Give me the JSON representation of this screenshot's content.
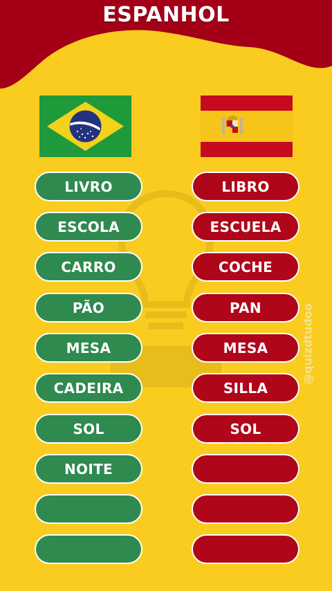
{
  "header": {
    "title": "ESPANHOL",
    "bg_color": "#a30017"
  },
  "colors": {
    "background": "#f9cc1f",
    "portuguese_pill": "#2e8a4f",
    "spanish_pill": "#b0061a"
  },
  "flags": {
    "left": "brazil-flag",
    "right": "spain-flag"
  },
  "words": [
    {
      "pt": "LIVRO",
      "es": "LIBRO"
    },
    {
      "pt": "ESCOLA",
      "es": "ESCUELA"
    },
    {
      "pt": "CARRO",
      "es": "COCHE"
    },
    {
      "pt": "PÃO",
      "es": "PAN"
    },
    {
      "pt": "MESA",
      "es": "MESA"
    },
    {
      "pt": "CADEIRA",
      "es": "SILLA"
    },
    {
      "pt": "SOL",
      "es": "SOL"
    },
    {
      "pt": "NOITE",
      "es": ""
    },
    {
      "pt": "",
      "es": ""
    },
    {
      "pt": "",
      "es": ""
    }
  ],
  "handle": "@quizdtudoo"
}
